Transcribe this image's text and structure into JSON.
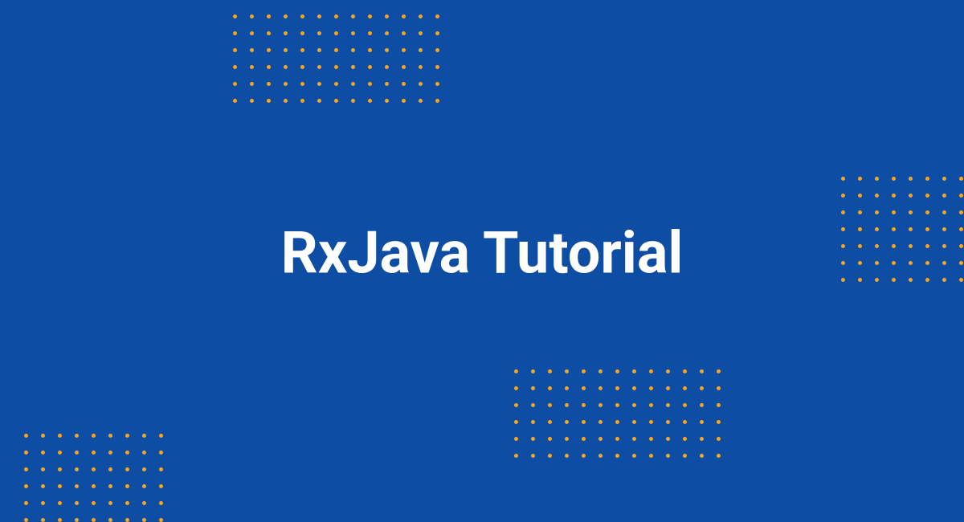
{
  "title": "RxJava Tutorial",
  "colors": {
    "background": "#0E4DA4",
    "dots": "#F5A623",
    "text": "#FFFFFF"
  },
  "decorations": {
    "top_grid": {
      "cols": 13,
      "rows": 6
    },
    "right_grid": {
      "cols": 9,
      "rows": 7
    },
    "bottom_right_grid": {
      "cols": 13,
      "rows": 6
    },
    "bottom_left_grid": {
      "cols": 9,
      "rows": 6
    }
  }
}
